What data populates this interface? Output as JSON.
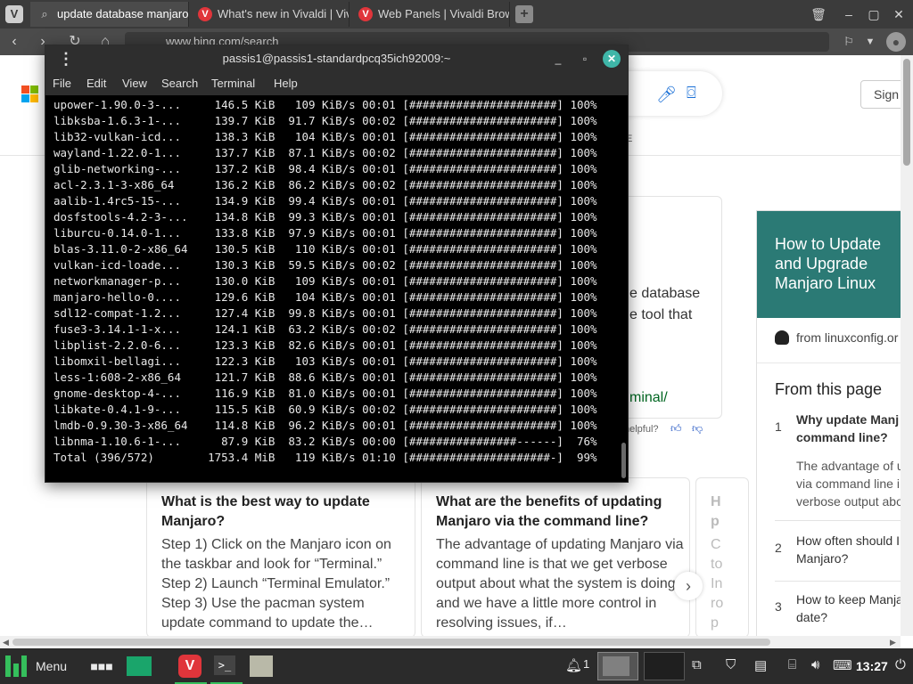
{
  "browser": {
    "tabs": [
      {
        "label": "update database manjaro -",
        "icon": "search-icon",
        "active": true
      },
      {
        "label": "What's new in Vivaldi | Viva",
        "icon": "vivaldi-icon",
        "active": false
      },
      {
        "label": "Web Panels | Vivaldi Brows",
        "icon": "vivaldi-icon",
        "active": false
      }
    ],
    "url": "www.bing.com/search",
    "window_controls": {
      "trash": "🗑",
      "minimize": "–",
      "maximize": "▢",
      "close": "✕"
    }
  },
  "bing": {
    "sign_in": "Sign",
    "tab_fragment": "E",
    "answer_text_line1": "e database",
    "answer_text_line2": "e tool that",
    "answer_link": "minal/",
    "helpful": "helpful?",
    "sidecard": {
      "title": "How to Update and Upgrade Manjaro Linux",
      "source": "from linuxconfig.or",
      "from_this_page": "From this page",
      "items": [
        {
          "num": "1",
          "title_line1": "Why update Manj",
          "title_line2": "command line?",
          "desc_line1": "The advantage of u",
          "desc_line2": "via command line i",
          "desc_line3": "verbose output abo"
        },
        {
          "num": "2",
          "title_line1": "How often should I",
          "title_line2": "Manjaro?"
        },
        {
          "num": "3",
          "title_line1": "How to keep Manja",
          "title_line2": "date?"
        }
      ]
    },
    "qa_cards": [
      {
        "title": "What is the best way to update Manjaro?",
        "body": "Step 1) Click on the Manjaro icon on the taskbar and look for “Terminal.” Step 2) Launch “Terminal Emulator.” Step 3) Use the pacman system update command to update the…"
      },
      {
        "title": "What are the benefits of updating Manjaro via the command line?",
        "body": "The advantage of updating Manjaro via command line is that we get verbose output about what the system is doing and we have a little more control in resolving issues, if…"
      },
      {
        "title": "H p",
        "body": "C to In ro p"
      }
    ]
  },
  "terminal": {
    "title": "passis1@passis1-standardpcq35ich92009:~",
    "menu": [
      "File",
      "Edit",
      "View",
      "Search",
      "Terminal",
      "Help"
    ],
    "lines": [
      "upower-1.90.0-3-...     146.5 KiB   109 KiB/s 00:01 [######################] 100%",
      "libksba-1.6.3-1-...     139.7 KiB  91.7 KiB/s 00:02 [######################] 100%",
      "lib32-vulkan-icd...     138.3 KiB   104 KiB/s 00:01 [######################] 100%",
      "wayland-1.22.0-1...     137.7 KiB  87.1 KiB/s 00:02 [######################] 100%",
      "glib-networking-...     137.2 KiB  98.4 KiB/s 00:01 [######################] 100%",
      "acl-2.3.1-3-x86_64      136.2 KiB  86.2 KiB/s 00:02 [######################] 100%",
      "aalib-1.4rc5-15-...     134.9 KiB  99.4 KiB/s 00:01 [######################] 100%",
      "dosfstools-4.2-3-...    134.8 KiB  99.3 KiB/s 00:01 [######################] 100%",
      "liburcu-0.14.0-1...     133.8 KiB  97.9 KiB/s 00:01 [######################] 100%",
      "blas-3.11.0-2-x86_64    130.5 KiB   110 KiB/s 00:01 [######################] 100%",
      "vulkan-icd-loade...     130.3 KiB  59.5 KiB/s 00:02 [######################] 100%",
      "networkmanager-p...     130.0 KiB   109 KiB/s 00:01 [######################] 100%",
      "manjaro-hello-0....     129.6 KiB   104 KiB/s 00:01 [######################] 100%",
      "sdl12-compat-1.2...     127.4 KiB  99.8 KiB/s 00:01 [######################] 100%",
      "fuse3-3.14.1-1-x...     124.1 KiB  63.2 KiB/s 00:02 [######################] 100%",
      "libplist-2.2.0-6...     123.3 KiB  82.6 KiB/s 00:01 [######################] 100%",
      "libomxil-bellagi...     122.3 KiB   103 KiB/s 00:01 [######################] 100%",
      "less-1:608-2-x86_64     121.7 KiB  88.6 KiB/s 00:01 [######################] 100%",
      "gnome-desktop-4-...     116.9 KiB  81.0 KiB/s 00:01 [######################] 100%",
      "libkate-0.4.1-9-...     115.5 KiB  60.9 KiB/s 00:02 [######################] 100%",
      "lmdb-0.9.30-3-x86_64    114.8 KiB  96.2 KiB/s 00:01 [######################] 100%",
      "libnma-1.10.6-1-...      87.9 KiB  83.2 KiB/s 00:00 [################------]  76%",
      "Total (396/572)        1753.4 MiB   119 KiB/s 01:10 [#####################-]  99%"
    ]
  },
  "taskbar": {
    "menu_label": "Menu",
    "notification_count": "1",
    "clock": "13:27"
  },
  "colors": {
    "terminal_close": "#3fb6a8",
    "sidecard_header": "#2b7a75",
    "manjaro_green": "#35bf5c",
    "vivaldi_red": "#e0353b",
    "link_green": "#006621"
  }
}
